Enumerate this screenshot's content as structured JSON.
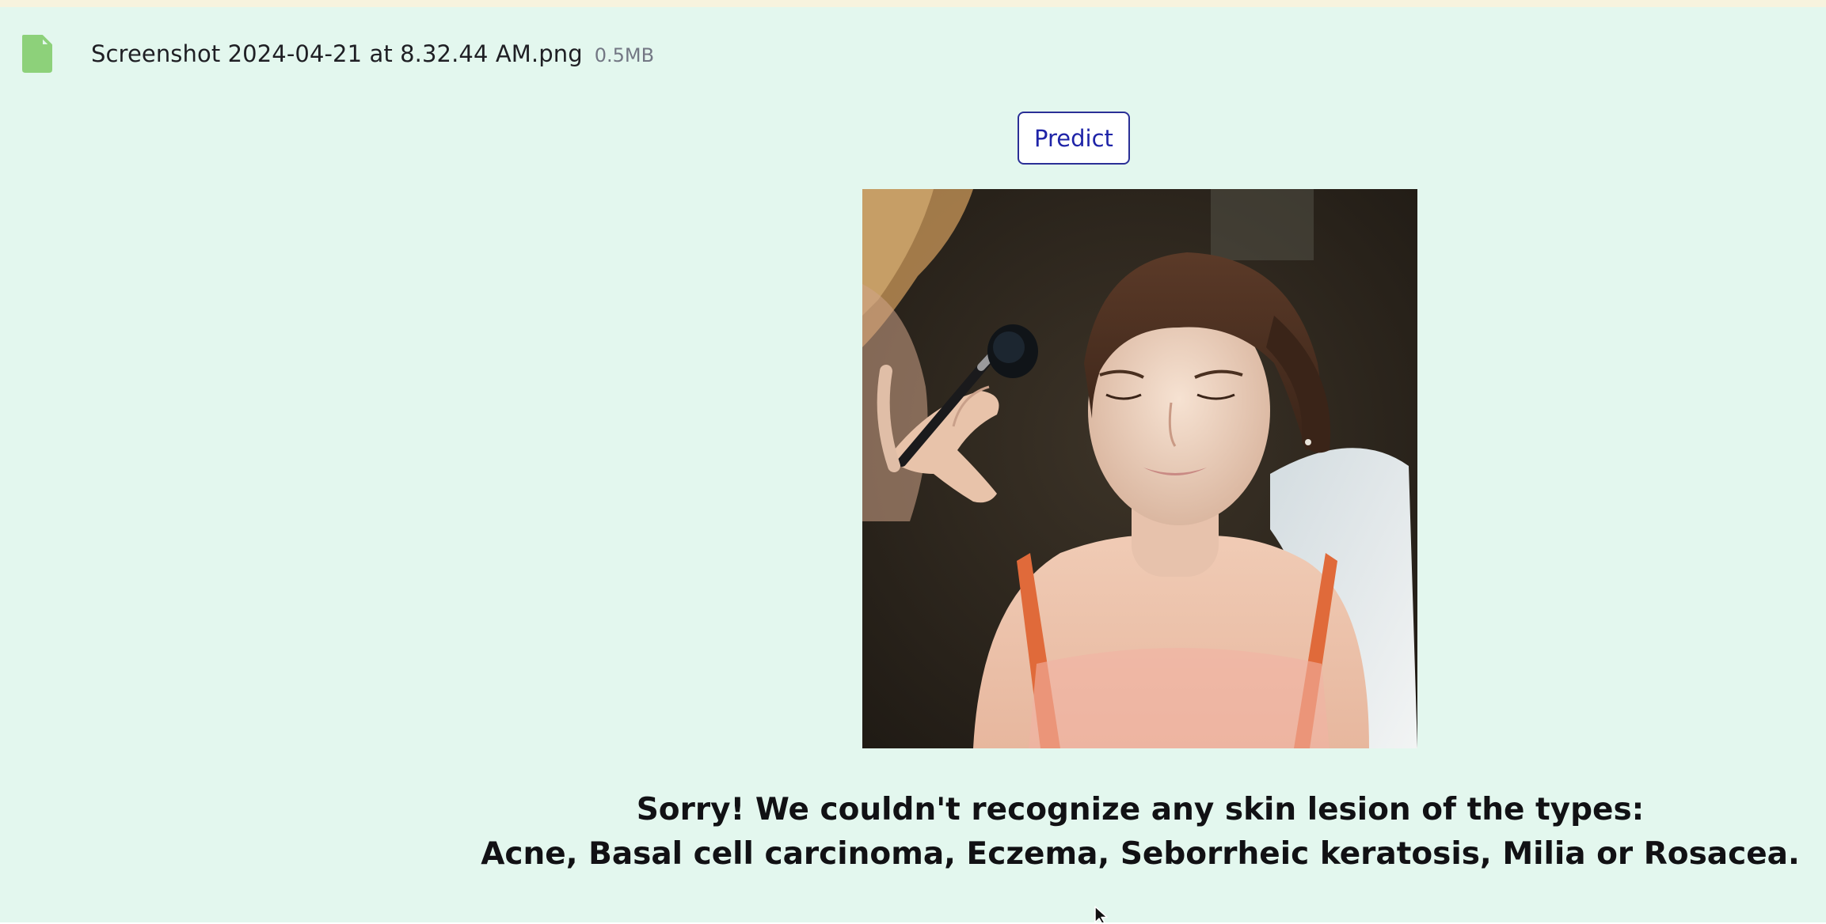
{
  "upload": {
    "file_name": "Screenshot 2024-04-21 at 8.32.44 AM.png",
    "file_size": "0.5MB",
    "icon": "file-icon"
  },
  "actions": {
    "predict_label": "Predict"
  },
  "image": {
    "subject": "woman having makeup applied with a brush"
  },
  "result": {
    "line1": "Sorry! We couldn't recognize any skin lesion of the types:",
    "line2": "Acne, Basal cell carcinoma, Eczema, Seborrheic keratosis, Milia or Rosacea."
  },
  "colors": {
    "background": "#e3f7ee",
    "top_strip": "#f7f3de",
    "accent": "#2a2f96",
    "file_icon": "#8dd17a"
  }
}
